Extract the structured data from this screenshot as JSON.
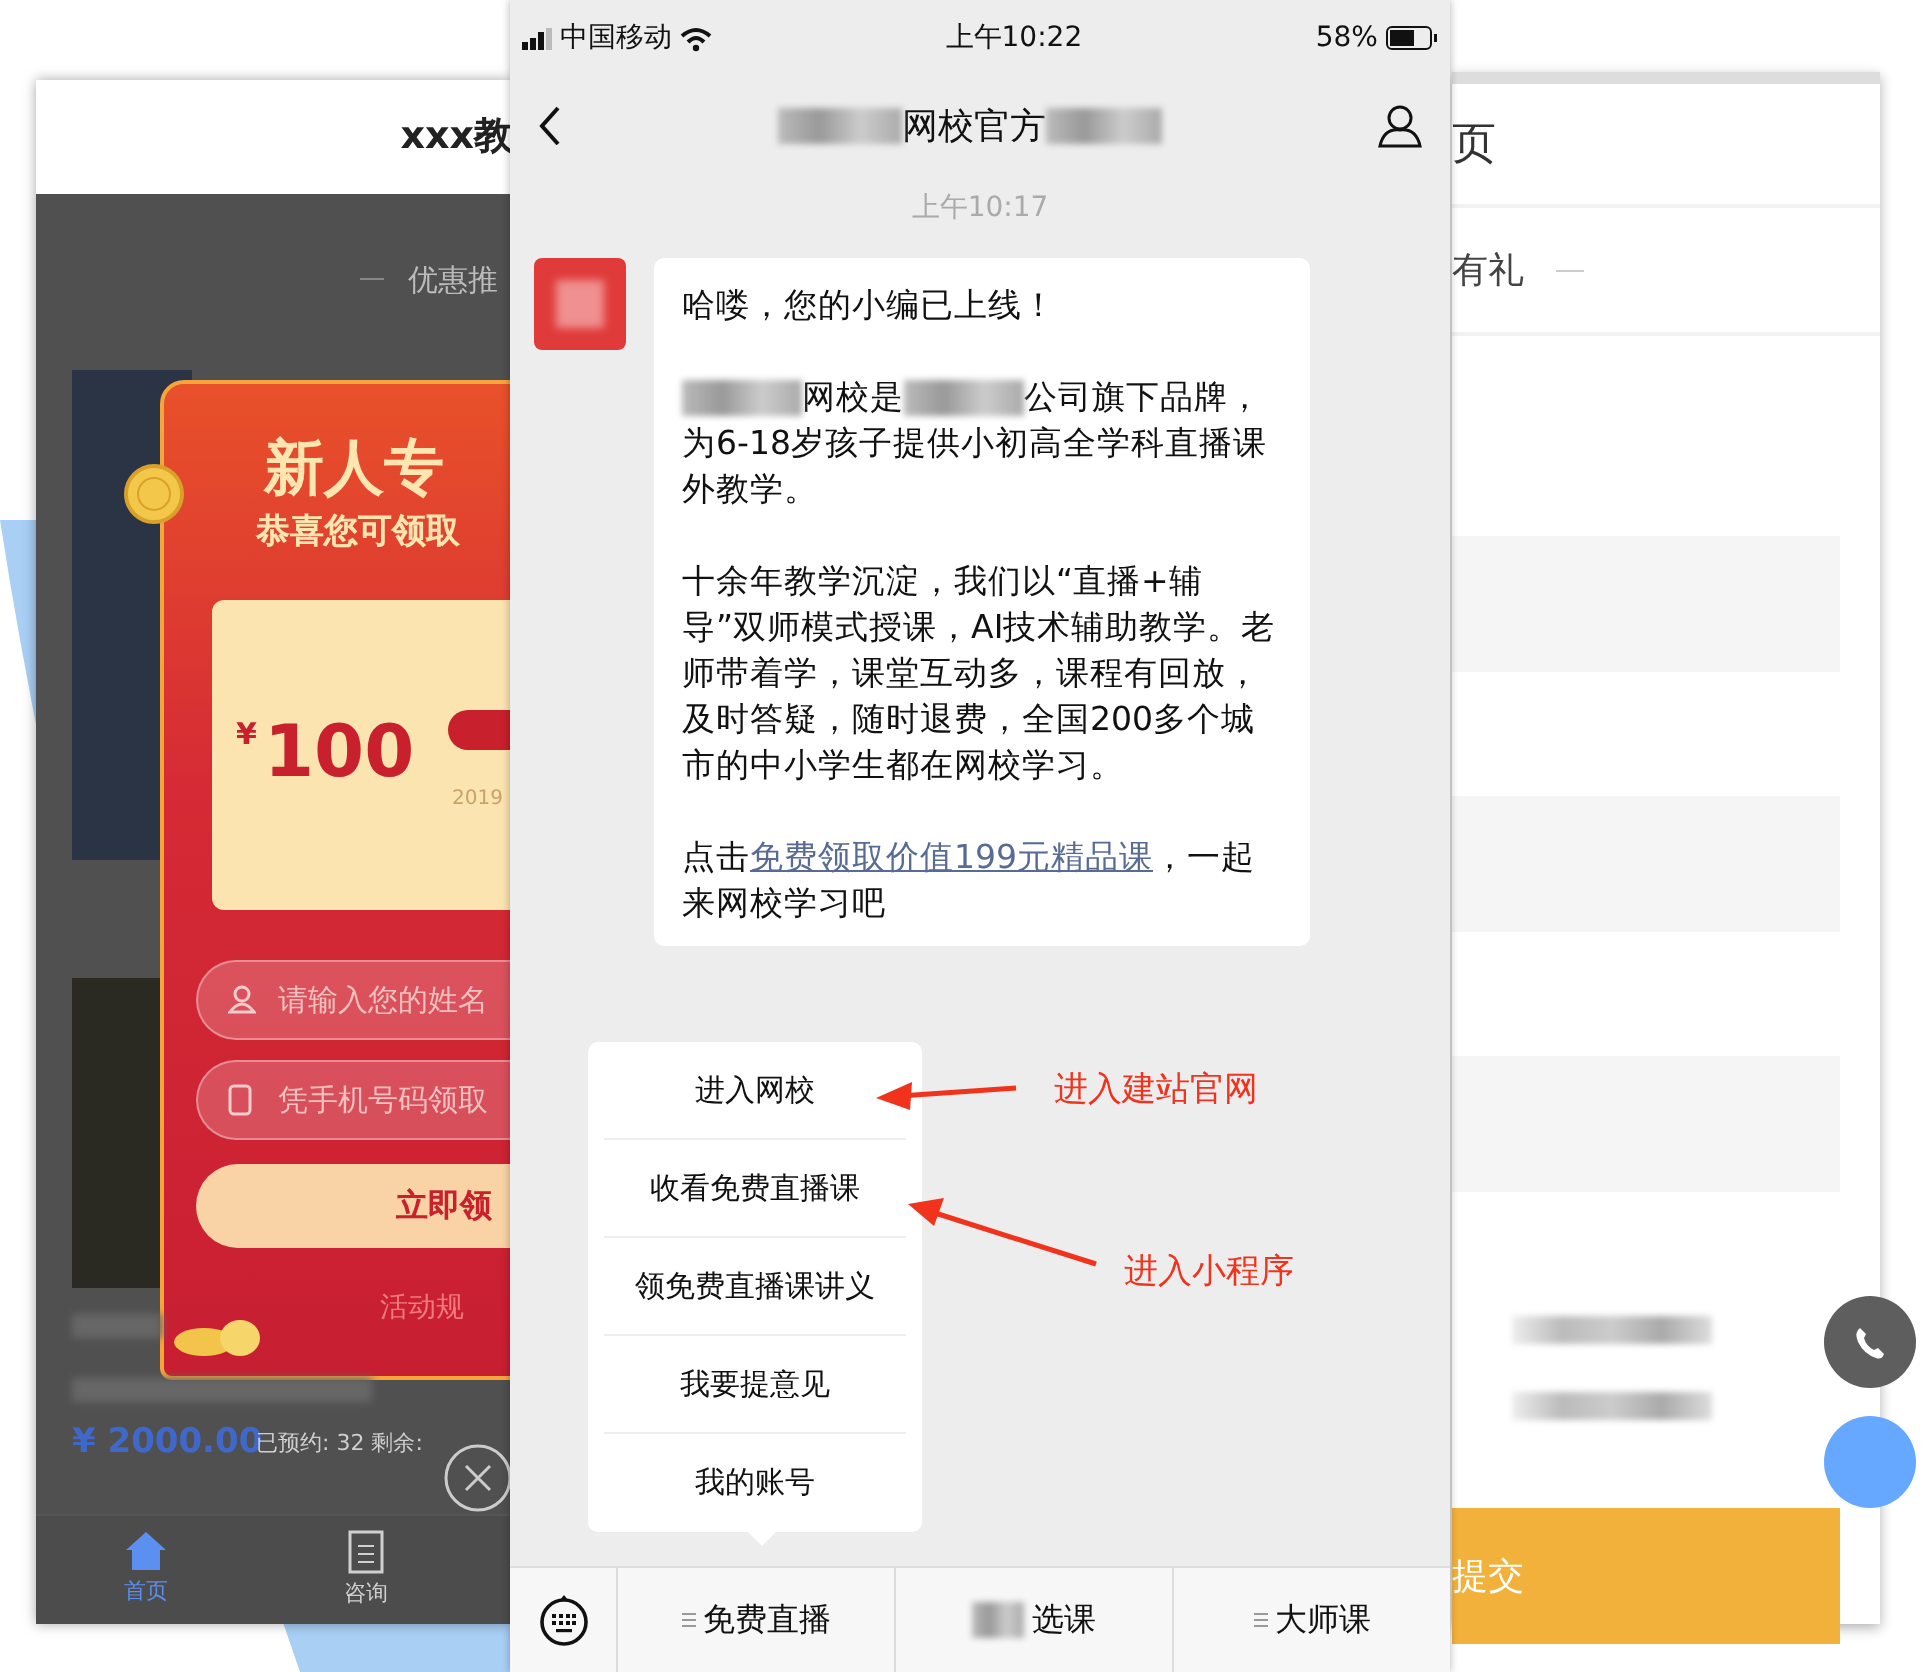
{
  "left_screen": {
    "title": "xxx教",
    "tab": "优惠推",
    "popup": {
      "heading": "新人专",
      "subheading": "恭喜您可领取",
      "coupon_currency": "¥",
      "coupon_amount": "100",
      "coupon_date": "2019",
      "name_placeholder": "请输入您的姓名",
      "phone_placeholder": "凭手机号码领取",
      "claim_button": "立即领",
      "rules_link": "活动规"
    },
    "price": "¥ 2000.00",
    "booking": "已预约: 32 剩余:",
    "tab_bar": [
      {
        "label": "首页",
        "selected": true
      },
      {
        "label": "咨询",
        "selected": false
      }
    ]
  },
  "phone": {
    "status_bar": {
      "carrier": "中国移动",
      "time": "上午10:22",
      "battery": "58%"
    },
    "nav": {
      "title": "网校官方"
    },
    "timestamp": "上午10:17",
    "message": {
      "paragraphs": [
        [
          {
            "kind": "text",
            "text": "哈喽，您的小编已上线！"
          }
        ],
        [
          {
            "kind": "blur"
          },
          {
            "kind": "text",
            "text": "网校是"
          },
          {
            "kind": "blur"
          },
          {
            "kind": "text",
            "text": "公司旗下品牌，为6-18岁孩子提供小初高全学科直播课外教学。"
          }
        ],
        [
          {
            "kind": "text",
            "text": "十余年教学沉淀，我们以“直播+辅导”双师模式授课，AI技术辅助教学。老师带着学，课堂互动多，课程有回放，及时答疑，随时退费，全国200多个城市的中小学生都在网校学习。"
          }
        ],
        [
          {
            "kind": "text",
            "text": "点击"
          },
          {
            "kind": "link",
            "text": "免费领取价值199元精品课"
          },
          {
            "kind": "text",
            "text": "，一起来网校学习吧"
          }
        ]
      ]
    },
    "menu": {
      "items": [
        "进入网校",
        "收看免费直播课",
        "领免费直播课讲义",
        "我要提意见",
        "我的账号"
      ]
    },
    "bottom_bar": {
      "items": [
        {
          "label": "免费直播",
          "icon": true
        },
        {
          "label": "选课",
          "icon": false
        },
        {
          "label": "大师课",
          "icon": true
        }
      ]
    }
  },
  "annotations": [
    {
      "text": "进入建站官网"
    },
    {
      "text": "进入小程序"
    }
  ],
  "right_screen": {
    "title": "页",
    "tab": "有礼",
    "submit_button": "提交"
  }
}
